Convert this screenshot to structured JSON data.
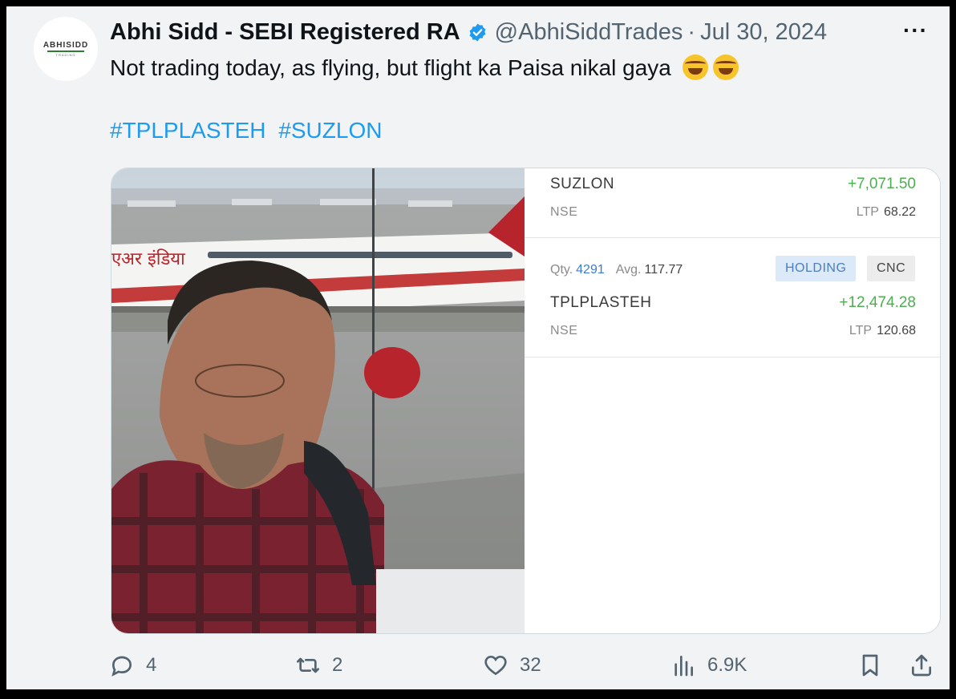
{
  "tweet": {
    "author_name": "Abhi Sidd - SEBI Registered RA",
    "handle": "@AbhiSiddTrades",
    "separator": "·",
    "date": "Jul 30, 2024",
    "more_label": "···",
    "avatar_brand": "ABHISIDD",
    "avatar_sub": "TRADING",
    "text": "Not trading today, as flying, but flight ka Paisa nikal gaya",
    "emojis": [
      "rolling-on-floor-laughing",
      "rolling-on-floor-laughing"
    ],
    "hashtags": [
      "#TPLPLASTEH",
      "#SUZLON"
    ],
    "verified_color": "#1d9bf0"
  },
  "holdings_panel": {
    "positions": [
      {
        "symbol": "SUZLON",
        "exchange": "NSE",
        "pnl": "+7,071.50",
        "ltp_label": "LTP",
        "ltp": "68.22"
      },
      {
        "qty_label": "Qty.",
        "qty": "4291",
        "avg_label": "Avg.",
        "avg": "117.77",
        "tags": [
          "HOLDING",
          "CNC"
        ],
        "symbol": "TPLPLASTEH",
        "exchange": "NSE",
        "pnl": "+12,474.28",
        "ltp_label": "LTP",
        "ltp": "120.68"
      }
    ],
    "profit_color": "#4caf50"
  },
  "actions": {
    "reply_count": "4",
    "retweet_count": "2",
    "like_count": "32",
    "views_count": "6.9K"
  }
}
